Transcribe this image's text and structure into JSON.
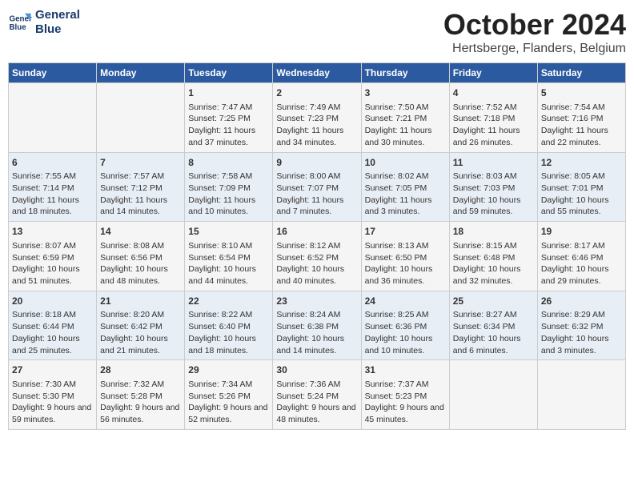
{
  "header": {
    "logo_line1": "General",
    "logo_line2": "Blue",
    "month_title": "October 2024",
    "location": "Hertsberge, Flanders, Belgium"
  },
  "days_of_week": [
    "Sunday",
    "Monday",
    "Tuesday",
    "Wednesday",
    "Thursday",
    "Friday",
    "Saturday"
  ],
  "weeks": [
    [
      {
        "day": "",
        "sunrise": "",
        "sunset": "",
        "daylight": ""
      },
      {
        "day": "",
        "sunrise": "",
        "sunset": "",
        "daylight": ""
      },
      {
        "day": "1",
        "sunrise": "Sunrise: 7:47 AM",
        "sunset": "Sunset: 7:25 PM",
        "daylight": "Daylight: 11 hours and 37 minutes."
      },
      {
        "day": "2",
        "sunrise": "Sunrise: 7:49 AM",
        "sunset": "Sunset: 7:23 PM",
        "daylight": "Daylight: 11 hours and 34 minutes."
      },
      {
        "day": "3",
        "sunrise": "Sunrise: 7:50 AM",
        "sunset": "Sunset: 7:21 PM",
        "daylight": "Daylight: 11 hours and 30 minutes."
      },
      {
        "day": "4",
        "sunrise": "Sunrise: 7:52 AM",
        "sunset": "Sunset: 7:18 PM",
        "daylight": "Daylight: 11 hours and 26 minutes."
      },
      {
        "day": "5",
        "sunrise": "Sunrise: 7:54 AM",
        "sunset": "Sunset: 7:16 PM",
        "daylight": "Daylight: 11 hours and 22 minutes."
      }
    ],
    [
      {
        "day": "6",
        "sunrise": "Sunrise: 7:55 AM",
        "sunset": "Sunset: 7:14 PM",
        "daylight": "Daylight: 11 hours and 18 minutes."
      },
      {
        "day": "7",
        "sunrise": "Sunrise: 7:57 AM",
        "sunset": "Sunset: 7:12 PM",
        "daylight": "Daylight: 11 hours and 14 minutes."
      },
      {
        "day": "8",
        "sunrise": "Sunrise: 7:58 AM",
        "sunset": "Sunset: 7:09 PM",
        "daylight": "Daylight: 11 hours and 10 minutes."
      },
      {
        "day": "9",
        "sunrise": "Sunrise: 8:00 AM",
        "sunset": "Sunset: 7:07 PM",
        "daylight": "Daylight: 11 hours and 7 minutes."
      },
      {
        "day": "10",
        "sunrise": "Sunrise: 8:02 AM",
        "sunset": "Sunset: 7:05 PM",
        "daylight": "Daylight: 11 hours and 3 minutes."
      },
      {
        "day": "11",
        "sunrise": "Sunrise: 8:03 AM",
        "sunset": "Sunset: 7:03 PM",
        "daylight": "Daylight: 10 hours and 59 minutes."
      },
      {
        "day": "12",
        "sunrise": "Sunrise: 8:05 AM",
        "sunset": "Sunset: 7:01 PM",
        "daylight": "Daylight: 10 hours and 55 minutes."
      }
    ],
    [
      {
        "day": "13",
        "sunrise": "Sunrise: 8:07 AM",
        "sunset": "Sunset: 6:59 PM",
        "daylight": "Daylight: 10 hours and 51 minutes."
      },
      {
        "day": "14",
        "sunrise": "Sunrise: 8:08 AM",
        "sunset": "Sunset: 6:56 PM",
        "daylight": "Daylight: 10 hours and 48 minutes."
      },
      {
        "day": "15",
        "sunrise": "Sunrise: 8:10 AM",
        "sunset": "Sunset: 6:54 PM",
        "daylight": "Daylight: 10 hours and 44 minutes."
      },
      {
        "day": "16",
        "sunrise": "Sunrise: 8:12 AM",
        "sunset": "Sunset: 6:52 PM",
        "daylight": "Daylight: 10 hours and 40 minutes."
      },
      {
        "day": "17",
        "sunrise": "Sunrise: 8:13 AM",
        "sunset": "Sunset: 6:50 PM",
        "daylight": "Daylight: 10 hours and 36 minutes."
      },
      {
        "day": "18",
        "sunrise": "Sunrise: 8:15 AM",
        "sunset": "Sunset: 6:48 PM",
        "daylight": "Daylight: 10 hours and 32 minutes."
      },
      {
        "day": "19",
        "sunrise": "Sunrise: 8:17 AM",
        "sunset": "Sunset: 6:46 PM",
        "daylight": "Daylight: 10 hours and 29 minutes."
      }
    ],
    [
      {
        "day": "20",
        "sunrise": "Sunrise: 8:18 AM",
        "sunset": "Sunset: 6:44 PM",
        "daylight": "Daylight: 10 hours and 25 minutes."
      },
      {
        "day": "21",
        "sunrise": "Sunrise: 8:20 AM",
        "sunset": "Sunset: 6:42 PM",
        "daylight": "Daylight: 10 hours and 21 minutes."
      },
      {
        "day": "22",
        "sunrise": "Sunrise: 8:22 AM",
        "sunset": "Sunset: 6:40 PM",
        "daylight": "Daylight: 10 hours and 18 minutes."
      },
      {
        "day": "23",
        "sunrise": "Sunrise: 8:24 AM",
        "sunset": "Sunset: 6:38 PM",
        "daylight": "Daylight: 10 hours and 14 minutes."
      },
      {
        "day": "24",
        "sunrise": "Sunrise: 8:25 AM",
        "sunset": "Sunset: 6:36 PM",
        "daylight": "Daylight: 10 hours and 10 minutes."
      },
      {
        "day": "25",
        "sunrise": "Sunrise: 8:27 AM",
        "sunset": "Sunset: 6:34 PM",
        "daylight": "Daylight: 10 hours and 6 minutes."
      },
      {
        "day": "26",
        "sunrise": "Sunrise: 8:29 AM",
        "sunset": "Sunset: 6:32 PM",
        "daylight": "Daylight: 10 hours and 3 minutes."
      }
    ],
    [
      {
        "day": "27",
        "sunrise": "Sunrise: 7:30 AM",
        "sunset": "Sunset: 5:30 PM",
        "daylight": "Daylight: 9 hours and 59 minutes."
      },
      {
        "day": "28",
        "sunrise": "Sunrise: 7:32 AM",
        "sunset": "Sunset: 5:28 PM",
        "daylight": "Daylight: 9 hours and 56 minutes."
      },
      {
        "day": "29",
        "sunrise": "Sunrise: 7:34 AM",
        "sunset": "Sunset: 5:26 PM",
        "daylight": "Daylight: 9 hours and 52 minutes."
      },
      {
        "day": "30",
        "sunrise": "Sunrise: 7:36 AM",
        "sunset": "Sunset: 5:24 PM",
        "daylight": "Daylight: 9 hours and 48 minutes."
      },
      {
        "day": "31",
        "sunrise": "Sunrise: 7:37 AM",
        "sunset": "Sunset: 5:23 PM",
        "daylight": "Daylight: 9 hours and 45 minutes."
      },
      {
        "day": "",
        "sunrise": "",
        "sunset": "",
        "daylight": ""
      },
      {
        "day": "",
        "sunrise": "",
        "sunset": "",
        "daylight": ""
      }
    ]
  ]
}
